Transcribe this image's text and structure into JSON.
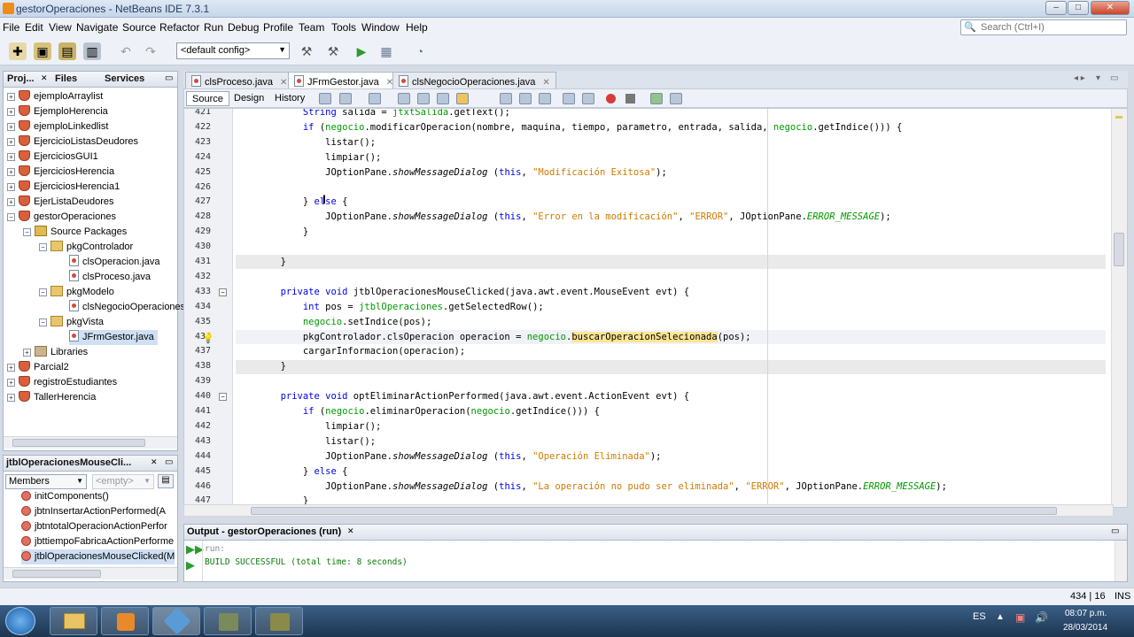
{
  "window": {
    "title": "gestorOperaciones - NetBeans IDE 7.3.1"
  },
  "menubar": [
    "File",
    "Edit",
    "View",
    "Navigate",
    "Source",
    "Refactor",
    "Run",
    "Debug",
    "Profile",
    "Team",
    "Tools",
    "Window",
    "Help"
  ],
  "search": {
    "placeholder": "Search (Ctrl+I)"
  },
  "toolbar": {
    "config": "<default config>"
  },
  "projects": {
    "tabs": [
      "Proj...",
      "Files",
      "Services"
    ],
    "items": [
      "ejemploArraylist",
      "EjemploHerencia",
      "ejemploLinkedlist",
      "EjercicioListasDeudores",
      "EjerciciosGUI1",
      "EjerciciosHerencia",
      "EjerciciosHerencia1",
      "EjerListaDeudores",
      "gestorOperaciones",
      "Source Packages",
      "pkgControlador",
      "clsOperacion.java",
      "clsProceso.java",
      "pkgModelo",
      "clsNegocioOperaciones",
      "pkgVista",
      "JFrmGestor.java",
      "Libraries",
      "Parcial2",
      "registroEstudiantes",
      "TallerHerencia"
    ]
  },
  "navigator": {
    "title": "jtblOperacionesMouseCli...",
    "filter": "Members",
    "empty": "<empty>",
    "members": [
      "initComponents()",
      "jbtnInsertarActionPerformed(A",
      "jbtntotalOperacionActionPerfor",
      "jbttiempoFabricaActionPerforme",
      "jtblOperacionesMouseClicked(M"
    ]
  },
  "editor": {
    "tabs": [
      "clsProceso.java",
      "JFrmGestor.java",
      "clsNegocioOperaciones.java"
    ],
    "modes": [
      "Source",
      "Design",
      "History"
    ],
    "lines": [
      {
        "n": "421",
        "t": "            String salida = jtxtSalida.getText();"
      },
      {
        "n": "422",
        "t": "            if (negocio.modificarOperacion(nombre, maquina, tiempo, parametro, entrada, salida, negocio.getIndice())) {"
      },
      {
        "n": "423",
        "t": "                listar();"
      },
      {
        "n": "424",
        "t": "                limpiar();"
      },
      {
        "n": "425",
        "t": "                JOptionPane.showMessageDialog (this, \"Modificación Exitosa\");"
      },
      {
        "n": "426",
        "t": ""
      },
      {
        "n": "427",
        "t": "            } else {"
      },
      {
        "n": "428",
        "t": "                JOptionPane.showMessageDialog (this, \"Error en la modificación\", \"ERROR\", JOptionPane.ERROR_MESSAGE);"
      },
      {
        "n": "429",
        "t": "            }"
      },
      {
        "n": "430",
        "t": ""
      },
      {
        "n": "431",
        "t": "        }"
      },
      {
        "n": "432",
        "t": ""
      },
      {
        "n": "433",
        "t": "        private void jtblOperacionesMouseClicked(java.awt.event.MouseEvent evt) {"
      },
      {
        "n": "434",
        "t": "            int pos = jtblOperaciones.getSelectedRow();"
      },
      {
        "n": "435",
        "t": "            negocio.setIndice(pos);"
      },
      {
        "n": "436",
        "t": "            pkgControlador.clsOperacion operacion = negocio.buscarOperacionSelecionada(pos);"
      },
      {
        "n": "437",
        "t": "            cargarInformacion(operacion);"
      },
      {
        "n": "438",
        "t": "        }"
      },
      {
        "n": "439",
        "t": ""
      },
      {
        "n": "440",
        "t": "        private void optEliminarActionPerformed(java.awt.event.ActionEvent evt) {"
      },
      {
        "n": "441",
        "t": "            if (negocio.eliminarOperacion(negocio.getIndice())) {"
      },
      {
        "n": "442",
        "t": "                limpiar();"
      },
      {
        "n": "443",
        "t": "                listar();"
      },
      {
        "n": "444",
        "t": "                JOptionPane.showMessageDialog (this, \"Operación Eliminada\");"
      },
      {
        "n": "445",
        "t": "            } else {"
      },
      {
        "n": "446",
        "t": "                JOptionPane.showMessageDialog (this, \"La operación no pudo ser eliminada\", \"ERROR\", JOptionPane.ERROR_MESSAGE);"
      },
      {
        "n": "447",
        "t": "            }"
      }
    ]
  },
  "output": {
    "title": "Output - gestorOperaciones (run)",
    "lines": [
      "run:",
      "BUILD SUCCESSFUL (total time: 8 seconds)"
    ]
  },
  "status": {
    "position": "434 | 16",
    "mode": "INS"
  },
  "taskbar": {
    "lang": "ES",
    "time": "08:07 p.m.",
    "date": "28/03/2014"
  }
}
